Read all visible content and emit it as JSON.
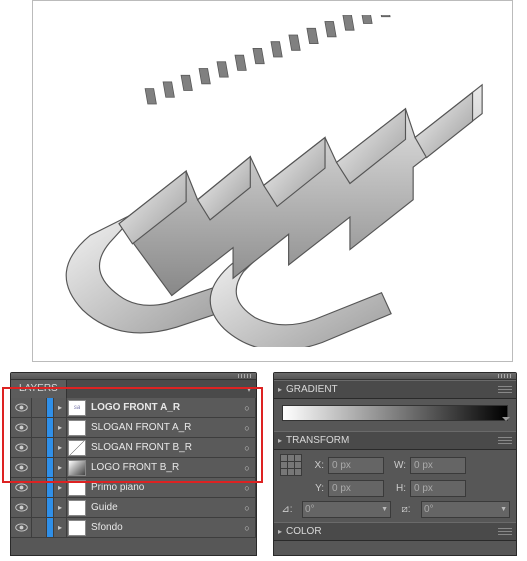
{
  "layers_panel": {
    "title": "LAYERS",
    "rows": [
      {
        "name": "LOGO FRONT A_R",
        "bold": true,
        "thumb": "logo"
      },
      {
        "name": "SLOGAN FRONT A_R",
        "bold": false,
        "thumb": "plain"
      },
      {
        "name": "SLOGAN FRONT B_R",
        "bold": false,
        "thumb": "diag"
      },
      {
        "name": "LOGO FRONT B_R",
        "bold": false,
        "thumb": "grad"
      },
      {
        "name": "Primo piano",
        "bold": false,
        "thumb": "plain"
      },
      {
        "name": "Guide",
        "bold": false,
        "thumb": "plain"
      },
      {
        "name": "Sfondo",
        "bold": false,
        "thumb": "plain"
      }
    ]
  },
  "gradient_panel": {
    "title": "GRADIENT"
  },
  "transform_panel": {
    "title": "TRANSFORM",
    "x_label": "X:",
    "x_value": "0 px",
    "y_label": "Y:",
    "y_value": "0 px",
    "w_label": "W:",
    "w_value": "0 px",
    "h_label": "H:",
    "h_value": "0 px",
    "rotate_label": "⊿:",
    "rotate_value": "0°",
    "shear_label": "⧄:",
    "shear_value": "0°"
  },
  "color_panel": {
    "title": "COLOR"
  }
}
